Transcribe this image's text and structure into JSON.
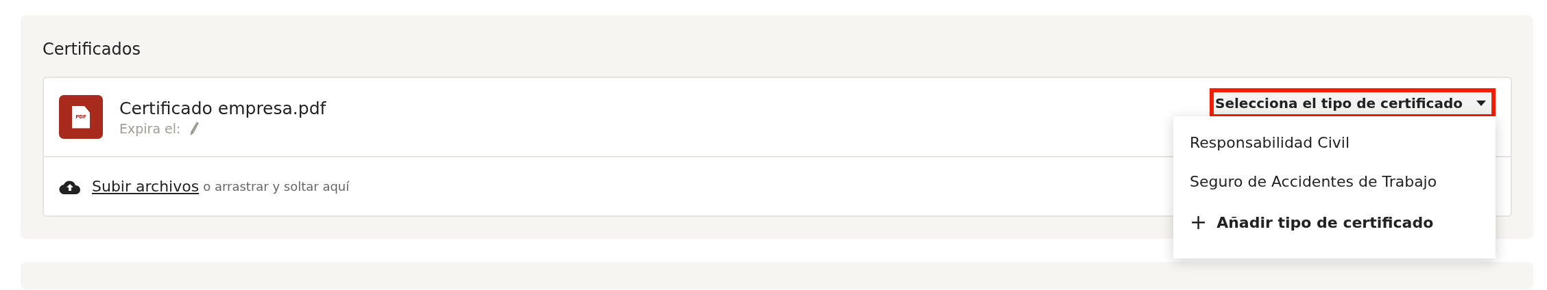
{
  "section": {
    "title": "Certificados"
  },
  "file": {
    "icon_label": "PDF",
    "name": "Certificado empresa.pdf",
    "expiry_label": "Expira el:"
  },
  "type_select": {
    "value": "Selecciona el tipo de certificado",
    "highlighted": true,
    "expanded": true
  },
  "menu": [
    {
      "kind": "option",
      "label": "Responsabilidad Civil"
    },
    {
      "kind": "option",
      "label": "Seguro de Accidentes de Trabajo"
    },
    {
      "kind": "add",
      "icon": "+",
      "label": "Añadir tipo de certificado"
    }
  ],
  "upload": {
    "link": "Subir archivos",
    "hint": "o arrastrar y soltar aquí"
  }
}
